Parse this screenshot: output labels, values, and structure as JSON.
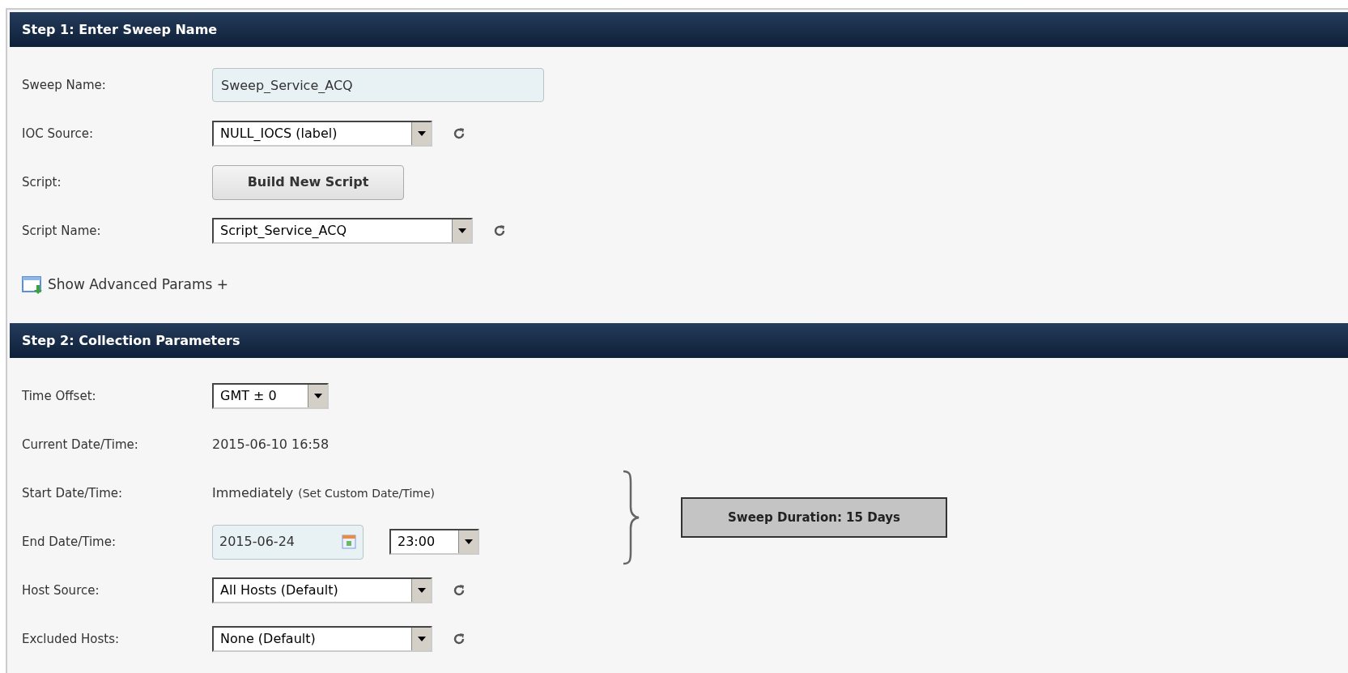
{
  "sections": [
    {
      "title": "Step 1: Enter Sweep Name",
      "rows": [
        {
          "kind": "text_field",
          "label": "Sweep Name:",
          "value": "Sweep_Service_ACQ"
        },
        {
          "kind": "select",
          "label": "IOC Source:",
          "value": "NULL_IOCS (label)",
          "refresh": true
        },
        {
          "kind": "button",
          "label": "Script:",
          "value": "Build New Script"
        },
        {
          "kind": "select",
          "label": "Script Name:",
          "value": "Script_Service_ACQ",
          "refresh": true
        },
        {
          "kind": "toggle_link",
          "value": "Show Advanced Params +"
        }
      ]
    },
    {
      "title": "Step 2: Collection Parameters",
      "rows": [
        {
          "kind": "select",
          "label": "Time Offset:",
          "value": "GMT ± 0",
          "refresh": false
        },
        {
          "kind": "text",
          "label": "Current Date/Time:",
          "value": "2015-06-10 16:58"
        },
        {
          "kind": "start",
          "label": "Start Date/Time:",
          "value": "Immediately",
          "link": "(Set Custom Date/Time)"
        },
        {
          "kind": "end",
          "label": "End Date/Time:",
          "date": "2015-06-24",
          "time": "23:00"
        },
        {
          "kind": "select",
          "label": "Host Source:",
          "value": "All Hosts (Default)",
          "refresh": true
        },
        {
          "kind": "select",
          "label": "Excluded Hosts:",
          "value": "None (Default)",
          "refresh": true
        }
      ],
      "duration": "Sweep Duration: 15 Days"
    }
  ]
}
